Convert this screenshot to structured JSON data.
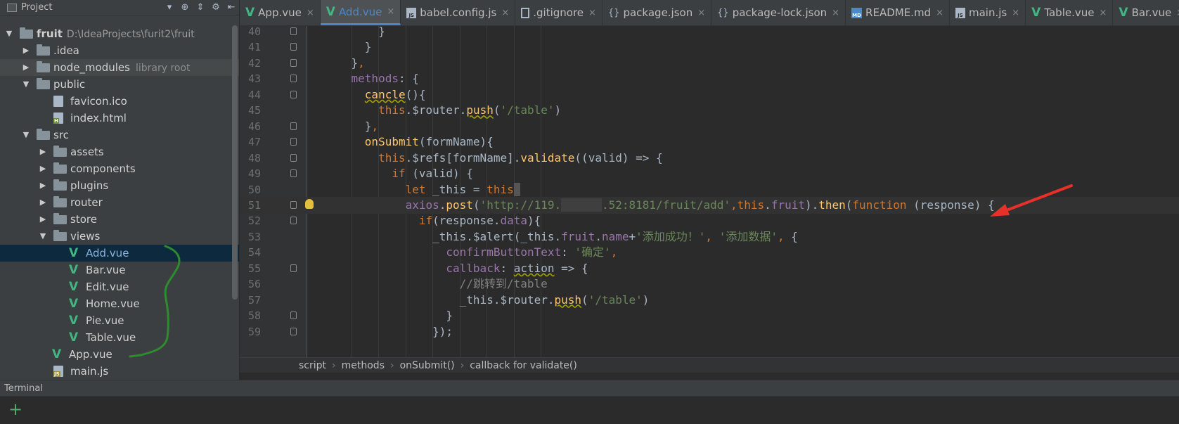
{
  "sidebar": {
    "title": "Project",
    "tree": [
      {
        "label": "fruit",
        "path": "D:\\IdeaProjects\\furit2\\fruit",
        "type": "folder",
        "arrow": "▼",
        "depth": 0,
        "bold": true
      },
      {
        "label": ".idea",
        "type": "folder",
        "arrow": "▶",
        "depth": 1
      },
      {
        "label": "node_modules",
        "sub": "library root",
        "type": "folder",
        "arrow": "▶",
        "depth": 1
      },
      {
        "label": "public",
        "type": "folder",
        "arrow": "▼",
        "depth": 1
      },
      {
        "label": "favicon.ico",
        "type": "file",
        "depth": 2
      },
      {
        "label": "index.html",
        "type": "html",
        "depth": 2
      },
      {
        "label": "src",
        "type": "folder",
        "arrow": "▼",
        "depth": 1
      },
      {
        "label": "assets",
        "type": "folder",
        "arrow": "▶",
        "depth": 2
      },
      {
        "label": "components",
        "type": "folder",
        "arrow": "▶",
        "depth": 2
      },
      {
        "label": "plugins",
        "type": "folder",
        "arrow": "▶",
        "depth": 2
      },
      {
        "label": "router",
        "type": "folder",
        "arrow": "▶",
        "depth": 2
      },
      {
        "label": "store",
        "type": "folder",
        "arrow": "▶",
        "depth": 2
      },
      {
        "label": "views",
        "type": "folder",
        "arrow": "▼",
        "depth": 2
      },
      {
        "label": "Add.vue",
        "type": "vue",
        "depth": 3,
        "selected": true
      },
      {
        "label": "Bar.vue",
        "type": "vue",
        "depth": 3
      },
      {
        "label": "Edit.vue",
        "type": "vue",
        "depth": 3
      },
      {
        "label": "Home.vue",
        "type": "vue",
        "depth": 3
      },
      {
        "label": "Pie.vue",
        "type": "vue",
        "depth": 3
      },
      {
        "label": "Table.vue",
        "type": "vue",
        "depth": 3
      },
      {
        "label": "App.vue",
        "type": "vue",
        "depth": 2
      },
      {
        "label": "main.js",
        "type": "js",
        "depth": 2
      }
    ]
  },
  "tabs": [
    {
      "label": "App.vue",
      "icon": "vue"
    },
    {
      "label": "Add.vue",
      "icon": "vue",
      "active": true
    },
    {
      "label": "babel.config.js",
      "icon": "js"
    },
    {
      "label": ".gitignore",
      "icon": "doc"
    },
    {
      "label": "package.json",
      "icon": "json"
    },
    {
      "label": "package-lock.json",
      "icon": "json"
    },
    {
      "label": "README.md",
      "icon": "md"
    },
    {
      "label": "main.js",
      "icon": "js"
    },
    {
      "label": "Table.vue",
      "icon": "vue"
    },
    {
      "label": "Bar.vue",
      "icon": "vue"
    }
  ],
  "editor": {
    "lines": [
      {
        "n": "40",
        "indent": "        ",
        "tokens": [
          {
            "t": "}"
          }
        ]
      },
      {
        "n": "41",
        "indent": "      ",
        "tokens": [
          {
            "t": "}"
          }
        ]
      },
      {
        "n": "42",
        "indent": "    ",
        "tokens": [
          {
            "t": "}"
          },
          {
            "t": ",",
            "c": "kw"
          }
        ]
      },
      {
        "n": "43",
        "indent": "    ",
        "tokens": [
          {
            "t": "methods",
            "c": "prop"
          },
          {
            "t": ": {"
          }
        ]
      },
      {
        "n": "44",
        "indent": "      ",
        "tokens": [
          {
            "t": "cancle",
            "c": "fn ul"
          },
          {
            "t": "(){"
          }
        ]
      },
      {
        "n": "45",
        "indent": "        ",
        "tokens": [
          {
            "t": "this",
            "c": "kw"
          },
          {
            "t": "."
          },
          {
            "t": "$router",
            "c": ""
          },
          {
            "t": "."
          },
          {
            "t": "push",
            "c": "fn ul"
          },
          {
            "t": "("
          },
          {
            "t": "'/table'",
            "c": "str"
          },
          {
            "t": ")"
          }
        ]
      },
      {
        "n": "46",
        "indent": "      ",
        "tokens": [
          {
            "t": "}"
          },
          {
            "t": ",",
            "c": "kw"
          }
        ]
      },
      {
        "n": "47",
        "indent": "      ",
        "tokens": [
          {
            "t": "onSubmit",
            "c": "fn"
          },
          {
            "t": "(formName){"
          }
        ]
      },
      {
        "n": "48",
        "indent": "        ",
        "tokens": [
          {
            "t": "this",
            "c": "kw"
          },
          {
            "t": ".$refs[formName]."
          },
          {
            "t": "validate",
            "c": "fn"
          },
          {
            "t": "((valid) => {"
          }
        ]
      },
      {
        "n": "49",
        "indent": "          ",
        "tokens": [
          {
            "t": "if",
            "c": "kw"
          },
          {
            "t": " (valid) {"
          }
        ]
      },
      {
        "n": "50",
        "indent": "            ",
        "tokens": [
          {
            "t": "let",
            "c": "kw"
          },
          {
            "t": " _this = "
          },
          {
            "t": "this",
            "c": "kw"
          },
          {
            "t": " ",
            "c": "caret-box"
          }
        ]
      },
      {
        "n": "51",
        "indent": "            ",
        "current": true,
        "bulb": true,
        "tokens": [
          {
            "t": "axios",
            "c": "prop"
          },
          {
            "t": "."
          },
          {
            "t": "post",
            "c": "fn"
          },
          {
            "t": "("
          },
          {
            "t": "'http://119.",
            "c": "str"
          },
          {
            "t": "      ",
            "c": "mask"
          },
          {
            "t": ".52:8181/fruit/add'",
            "c": "str"
          },
          {
            "t": ",",
            "c": "kw"
          },
          {
            "t": "this",
            "c": "kw"
          },
          {
            "t": "."
          },
          {
            "t": "fruit",
            "c": "prop"
          },
          {
            "t": ")."
          },
          {
            "t": "then",
            "c": "fn"
          },
          {
            "t": "("
          },
          {
            "t": "function",
            "c": "kw"
          },
          {
            "t": " (response) {"
          }
        ]
      },
      {
        "n": "52",
        "indent": "              ",
        "tokens": [
          {
            "t": "if",
            "c": "kw"
          },
          {
            "t": "(response."
          },
          {
            "t": "data",
            "c": "prop"
          },
          {
            "t": "){"
          }
        ]
      },
      {
        "n": "53",
        "indent": "                ",
        "tokens": [
          {
            "t": "_this.$alert(_this."
          },
          {
            "t": "fruit",
            "c": "prop"
          },
          {
            "t": "."
          },
          {
            "t": "name",
            "c": "prop"
          },
          {
            "t": "+"
          },
          {
            "t": "'添加成功！'",
            "c": "str"
          },
          {
            "t": ", ",
            "c": "kw"
          },
          {
            "t": "'添加数据'",
            "c": "str"
          },
          {
            "t": ", ",
            "c": "kw"
          },
          {
            "t": "{"
          }
        ]
      },
      {
        "n": "54",
        "indent": "                  ",
        "tokens": [
          {
            "t": "confirmButtonText",
            "c": "prop"
          },
          {
            "t": ": "
          },
          {
            "t": "'确定'",
            "c": "str"
          },
          {
            "t": ",",
            "c": "kw"
          }
        ]
      },
      {
        "n": "55",
        "indent": "                  ",
        "tokens": [
          {
            "t": "callback",
            "c": "prop"
          },
          {
            "t": ": "
          },
          {
            "t": "action",
            "c": "ul"
          },
          {
            "t": " => {"
          }
        ]
      },
      {
        "n": "56",
        "indent": "                    ",
        "tokens": [
          {
            "t": "//跳转到/table",
            "c": "cm"
          }
        ]
      },
      {
        "n": "57",
        "indent": "                    ",
        "tokens": [
          {
            "t": "_this.$router."
          },
          {
            "t": "push",
            "c": "fn ul"
          },
          {
            "t": "("
          },
          {
            "t": "'/table'",
            "c": "str"
          },
          {
            "t": ")"
          }
        ]
      },
      {
        "n": "58",
        "indent": "                  ",
        "tokens": [
          {
            "t": "}"
          }
        ]
      },
      {
        "n": "59",
        "indent": "                ",
        "tokens": [
          {
            "t": "});"
          }
        ]
      }
    ]
  },
  "breadcrumb": [
    "script",
    "methods",
    "onSubmit()",
    "callback for validate()"
  ],
  "terminal": {
    "title": "Terminal",
    "add_glyph": "+"
  },
  "colors": {
    "accent": "#4a88c7",
    "vue": "#41b883",
    "arrow": "#e8302a",
    "scribble": "#2e8b2e"
  }
}
